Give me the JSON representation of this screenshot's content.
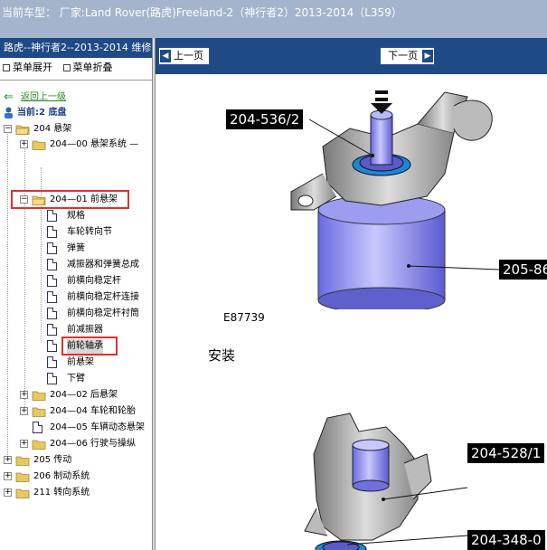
{
  "window": {
    "title": "当前车型：  厂家:Land Rover(路虎)Freeland-2（神行者2）2013-2014（L359）"
  },
  "sidebar": {
    "header": "路虎--神行者2--2013-2014 维修",
    "menu_expand": "菜单展开",
    "menu_collapse": "菜单折叠",
    "back_link": "返回上一级",
    "current_label": "当前:2 底盘",
    "tree": {
      "n204": "204 悬架",
      "n204_00": "204—00 悬架系统 —",
      "n204_01": "204—01 前悬架",
      "leaf1": "规格",
      "leaf2": "车轮转向节",
      "leaf3": "弹簧",
      "leaf4": "减振器和弹簧总成",
      "leaf5": "前横向稳定杆",
      "leaf6": "前横向稳定杆连接",
      "leaf7": "前横向稳定杆衬筒",
      "leaf8": "前减振器",
      "leaf9": "前轮轴承",
      "leaf10": "前悬架",
      "leaf11": "下臂",
      "n204_02": "204—02 后悬架",
      "n204_04": "204—04 车轮和轮胎",
      "n204_05": "204—05 车辆动态悬架",
      "n204_06": "204—06 行驶与操纵",
      "n205": "205 传动",
      "n206": "206 制动系统",
      "n211": "211 转向系统"
    }
  },
  "content": {
    "prev_page": "上一页",
    "next_page": "下一页",
    "callouts": {
      "c1": "204-536/2",
      "c2": "205-86",
      "c3": "204-528/1",
      "c4": "204-348-0"
    },
    "figure_code": "E87739",
    "install_heading": "安装"
  },
  "colors": {
    "header_blue": "#1e4a86",
    "titlebar": "#a4b4cc",
    "highlight_red": "#e03030",
    "tool_purple": "#8c8ce8"
  }
}
